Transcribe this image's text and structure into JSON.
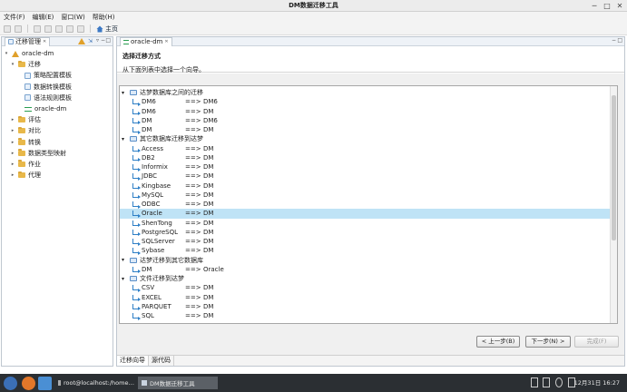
{
  "window": {
    "title": "DM数据迁移工具",
    "minimize": "─",
    "maximize": "□",
    "close": "✕"
  },
  "menu": [
    "文件(F)",
    "编辑(E)",
    "窗口(W)",
    "帮助(H)"
  ],
  "toolbar": {
    "home_label": "主页"
  },
  "left_panel": {
    "title": "迁移管理",
    "tree": [
      {
        "label": "oracle-dm",
        "icon": "warning-icon",
        "level": 0,
        "arrow": "▾"
      },
      {
        "label": "迁移",
        "icon": "folder-open-icon",
        "level": 1,
        "arrow": "▾"
      },
      {
        "label": "策略配置模板",
        "icon": "template-icon",
        "level": 2,
        "arrow": ""
      },
      {
        "label": "数据转换模板",
        "icon": "template-icon",
        "level": 2,
        "arrow": ""
      },
      {
        "label": "语法规则模板",
        "icon": "template-icon",
        "level": 2,
        "arrow": ""
      },
      {
        "label": "oracle-dm",
        "icon": "migration-link-icon",
        "level": 2,
        "arrow": ""
      },
      {
        "label": "评估",
        "icon": "folder-icon",
        "level": 1,
        "arrow": "▸"
      },
      {
        "label": "对比",
        "icon": "folder-icon",
        "level": 1,
        "arrow": "▸"
      },
      {
        "label": "转换",
        "icon": "folder-icon",
        "level": 1,
        "arrow": "▸"
      },
      {
        "label": "数据类型映射",
        "icon": "folder-icon",
        "level": 1,
        "arrow": "▸"
      },
      {
        "label": "作业",
        "icon": "folder-icon",
        "level": 1,
        "arrow": "▸"
      },
      {
        "label": "代理",
        "icon": "folder-icon",
        "level": 1,
        "arrow": "▸"
      }
    ]
  },
  "editor": {
    "tab_title": "oracle-dm",
    "wizard_title": "选择迁移方式",
    "wizard_subtitle": "从下面列表中选择一个向导。",
    "rows": [
      {
        "type": "group",
        "label": "达梦数据库之间的迁移"
      },
      {
        "type": "item",
        "src": "DM6",
        "arrow": "==>",
        "dst": "DM6"
      },
      {
        "type": "item",
        "src": "DM6",
        "arrow": "==>",
        "dst": "DM"
      },
      {
        "type": "item",
        "src": "DM",
        "arrow": "==>",
        "dst": "DM6"
      },
      {
        "type": "item",
        "src": "DM",
        "arrow": "==>",
        "dst": "DM"
      },
      {
        "type": "group",
        "label": "其它数据库迁移到达梦"
      },
      {
        "type": "item",
        "src": "Access",
        "arrow": "==>",
        "dst": "DM"
      },
      {
        "type": "item",
        "src": "DB2",
        "arrow": "==>",
        "dst": "DM"
      },
      {
        "type": "item",
        "src": "Informix",
        "arrow": "==>",
        "dst": "DM"
      },
      {
        "type": "item",
        "src": "JDBC",
        "arrow": "==>",
        "dst": "DM"
      },
      {
        "type": "item",
        "src": "Kingbase",
        "arrow": "==>",
        "dst": "DM"
      },
      {
        "type": "item",
        "src": "MySQL",
        "arrow": "==>",
        "dst": "DM"
      },
      {
        "type": "item",
        "src": "ODBC",
        "arrow": "==>",
        "dst": "DM"
      },
      {
        "type": "item",
        "src": "Oracle",
        "arrow": "==>",
        "dst": "DM",
        "selected": true
      },
      {
        "type": "item",
        "src": "ShenTong",
        "arrow": "==>",
        "dst": "DM"
      },
      {
        "type": "item",
        "src": "PostgreSQL",
        "arrow": "==>",
        "dst": "DM"
      },
      {
        "type": "item",
        "src": "SQLServer",
        "arrow": "==>",
        "dst": "DM"
      },
      {
        "type": "item",
        "src": "Sybase",
        "arrow": "==>",
        "dst": "DM"
      },
      {
        "type": "group",
        "label": "达梦迁移到其它数据库"
      },
      {
        "type": "item",
        "src": "DM",
        "arrow": "==>",
        "dst": "Oracle"
      },
      {
        "type": "group",
        "label": "文件迁移到达梦"
      },
      {
        "type": "item",
        "src": "CSV",
        "arrow": "==>",
        "dst": "DM"
      },
      {
        "type": "item",
        "src": "EXCEL",
        "arrow": "==>",
        "dst": "DM"
      },
      {
        "type": "item",
        "src": "PARQUET",
        "arrow": "==>",
        "dst": "DM"
      },
      {
        "type": "item",
        "src": "SQL",
        "arrow": "==>",
        "dst": "DM"
      }
    ],
    "buttons": {
      "back": "< 上一步(B)",
      "next": "下一步(N) >",
      "finish": "完成(F)"
    },
    "bottom_tabs": [
      "迁移向导",
      "源代码"
    ]
  },
  "taskbar": {
    "tasks": [
      "root@localhost:/home…",
      "DM数据迁移工具"
    ],
    "clock": "12月31日 16:27"
  }
}
